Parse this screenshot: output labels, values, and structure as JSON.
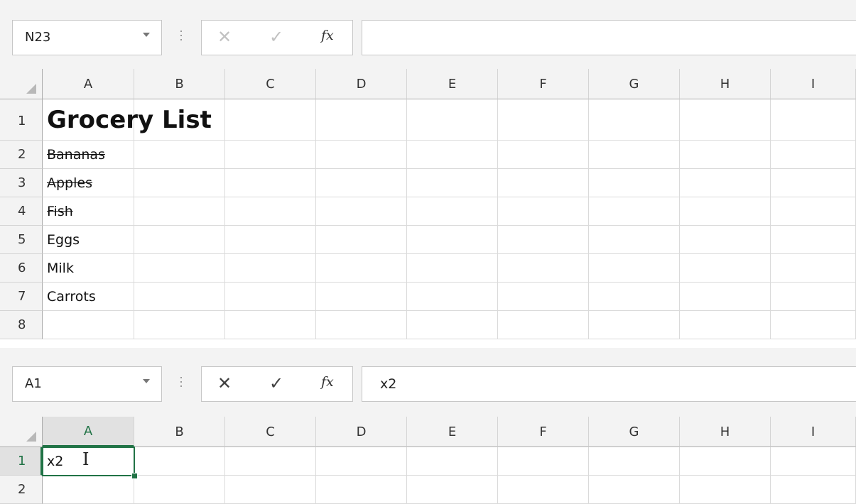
{
  "accent": "#217346",
  "panel1": {
    "name_box": "N23",
    "formula_value": "",
    "buttons": {
      "cancel": "✕",
      "enter": "✓",
      "fx": "fx"
    },
    "columns": [
      "A",
      "B",
      "C",
      "D",
      "E",
      "F",
      "G",
      "H",
      "I"
    ],
    "rows": [
      "1",
      "2",
      "3",
      "4",
      "5",
      "6",
      "7",
      "8"
    ],
    "cells": {
      "A1": "Grocery List",
      "A2": "Bananas",
      "A3": "Apples",
      "A4": "Fish",
      "A5": "Eggs",
      "A6": "Milk",
      "A7": "Carrots"
    }
  },
  "panel2": {
    "name_box": "A1",
    "formula_value": "x2",
    "buttons": {
      "cancel": "✕",
      "enter": "✓",
      "fx": "fx"
    },
    "columns": [
      "A",
      "B",
      "C",
      "D",
      "E",
      "F",
      "G",
      "H",
      "I"
    ],
    "rows": [
      "1",
      "2"
    ],
    "cells": {
      "A1": "x2"
    },
    "cursor": "I"
  }
}
